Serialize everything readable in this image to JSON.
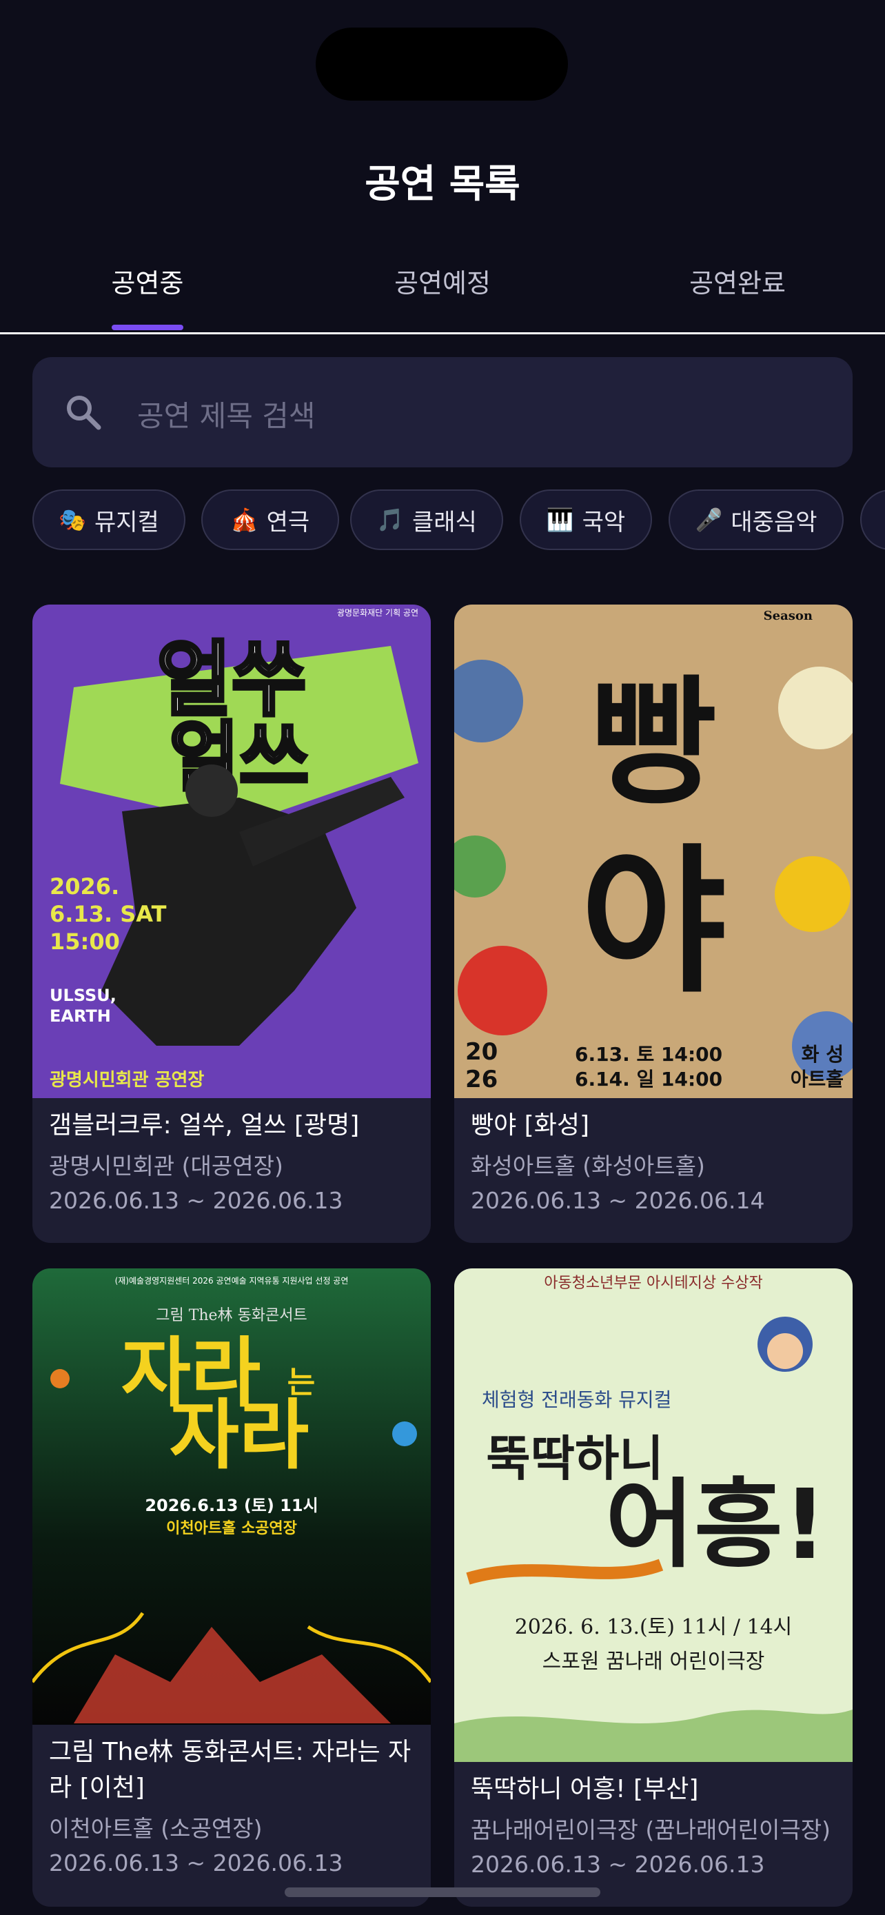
{
  "header": {
    "title": "공연 목록"
  },
  "tabs": [
    {
      "label": "공연중",
      "active": true
    },
    {
      "label": "공연예정",
      "active": false
    },
    {
      "label": "공연완료",
      "active": false
    }
  ],
  "search": {
    "placeholder": "공연 제목 검색"
  },
  "categories": [
    {
      "label": "뮤지컬",
      "icon": "🎭"
    },
    {
      "label": "연극",
      "icon": "🎪"
    },
    {
      "label": "클래식",
      "icon": "🎵"
    },
    {
      "label": "국악",
      "icon": "🎹"
    },
    {
      "label": "대중음악",
      "icon": "🎤"
    }
  ],
  "colors": {
    "accent": "#7a4cf2",
    "background": "#0d0d1a",
    "card": "#1e1e33"
  },
  "performances": [
    {
      "title": "갬블러크루: 얼쑤, 얼쓰 [광명]",
      "venue": "광명시민회관 (대공연장)",
      "dates": "2026.06.13 ~ 2026.06.13",
      "poster": {
        "org": "광명문화재단 기획 공연",
        "headline_1": "얼쑤",
        "headline_2": "얼쓰",
        "date": "2026.",
        "day": "6.13. SAT",
        "time": "15:00",
        "sub_1": "ULSSU,",
        "sub_2": "EARTH",
        "venue": "광명시민회관 공연장"
      }
    },
    {
      "title": "빵야 [화성]",
      "venue": "화성아트홀 (화성아트홀)",
      "dates": "2026.06.13 ~ 2026.06.14",
      "poster": {
        "headline_1": "빵",
        "headline_2": "야",
        "year_1": "20",
        "year_2": "26",
        "line_1": "6.13. 토  14:00",
        "line_2": "6.14. 일  14:00",
        "venue_1": "화  성",
        "venue_2": "아트홀",
        "tag": "Season"
      }
    },
    {
      "title": "그림 The林 동화콘서트: 자라는 자라 [이천]",
      "venue": "이천아트홀 (소공연장)",
      "dates": "2026.06.13 ~ 2026.06.13",
      "poster": {
        "top": "(재)예술경영지원센터 2026 공연예술 지역유통 지원사업 선정 공연",
        "series": "그림 The林 동화콘서트",
        "headline_1": "자라",
        "headline_small": "는",
        "headline_2": "자라",
        "date": "2026.6.13 (토) 11시",
        "venue": "이천아트홀 소공연장"
      }
    },
    {
      "title": "뚝딱하니 어흥! [부산]",
      "venue": "꿈나래어린이극장 (꿈나래어린이극장)",
      "dates": "2026.06.13 ~ 2026.06.13",
      "poster": {
        "top": "아동청소년부문 아시테지상 수상작",
        "sub": "체험형 전래동화 뮤지컬",
        "headline_1": "뚝딱하니",
        "headline_2": "어흥!",
        "date": "2026. 6. 13.(토) 11시 / 14시",
        "venue": "스포원 꿈나래 어린이극장"
      }
    }
  ]
}
